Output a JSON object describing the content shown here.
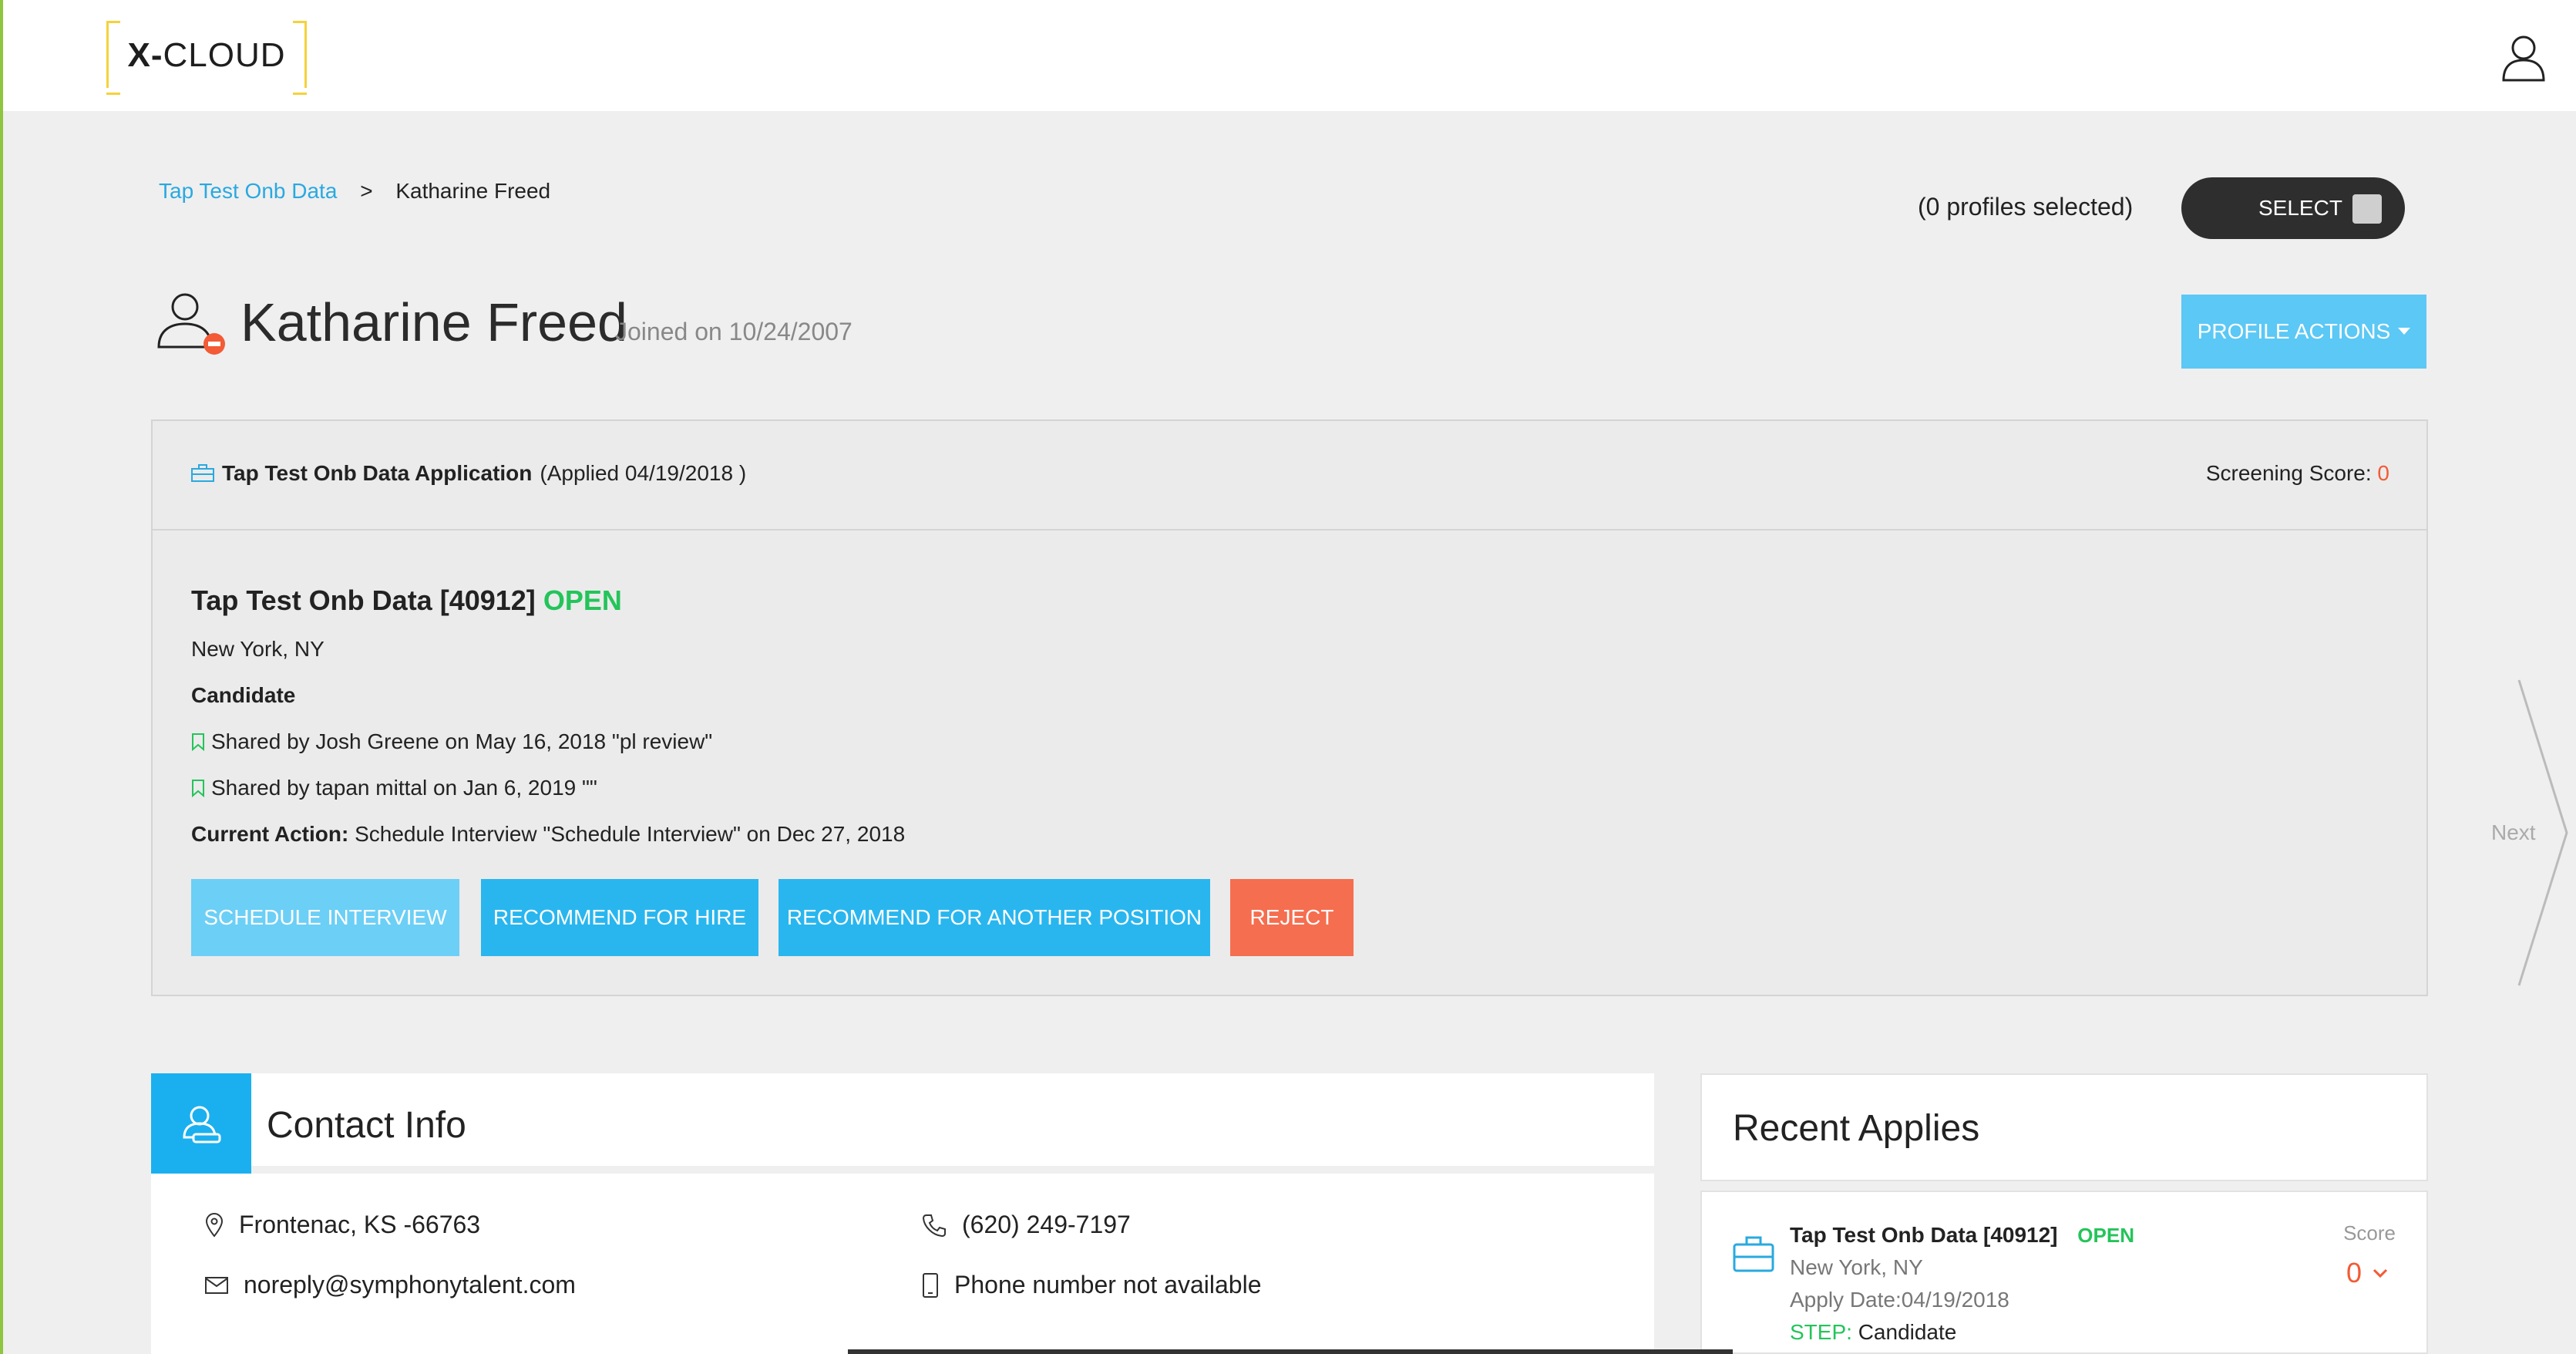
{
  "header": {
    "logo_bold": "X-",
    "logo_text": "CLOUD",
    "user_icon": "user-icon"
  },
  "breadcrumb": {
    "parent": "Tap Test Onb Data",
    "separator": ">",
    "current": "Katharine Freed"
  },
  "selection": {
    "profiles_selected": "(0 profiles selected)",
    "select_label": "SELECT"
  },
  "profile": {
    "name": "Katharine Freed",
    "joined": "Joined on 10/24/2007",
    "actions_label": "PROFILE ACTIONS"
  },
  "application": {
    "title_bold": "Tap Test Onb Data Application",
    "applied": "(Applied 04/19/2018 )",
    "screening_label": "Screening Score:",
    "screening_score": "0",
    "job_title": "Tap Test Onb Data [40912]",
    "job_status": "OPEN",
    "location": "New York, NY",
    "stage": "Candidate",
    "shared": [
      "Shared by Josh Greene on May 16, 2018 \"pl review\"",
      "Shared by tapan mittal on Jan 6, 2019 \"\""
    ],
    "current_action_label": "Current Action:",
    "current_action": " Schedule Interview \"Schedule Interview\" on Dec 27, 2018",
    "buttons": {
      "schedule": "SCHEDULE INTERVIEW",
      "hire": "RECOMMEND FOR HIRE",
      "another": "RECOMMEND FOR ANOTHER POSITION",
      "reject": "REJECT"
    }
  },
  "nav": {
    "next_label": "Next"
  },
  "contact": {
    "title": "Contact Info",
    "address": "Frontenac, KS -66763",
    "email": "noreply@symphonytalent.com",
    "phone": "(620) 249-7197",
    "mobile": "Phone number not available"
  },
  "recent": {
    "title": "Recent Applies",
    "items": [
      {
        "title": "Tap Test Onb Data [40912]",
        "status": "OPEN",
        "location": "New York, NY",
        "apply_date": "Apply Date:04/19/2018",
        "step_label": "STEP:",
        "step": " Candidate",
        "score_label": "Score",
        "score": "0"
      }
    ]
  },
  "colors": {
    "accent": "#29b6ef",
    "open_green": "#24c45a",
    "reject": "#f56e4f",
    "logo_yellow": "#f5d23c"
  }
}
